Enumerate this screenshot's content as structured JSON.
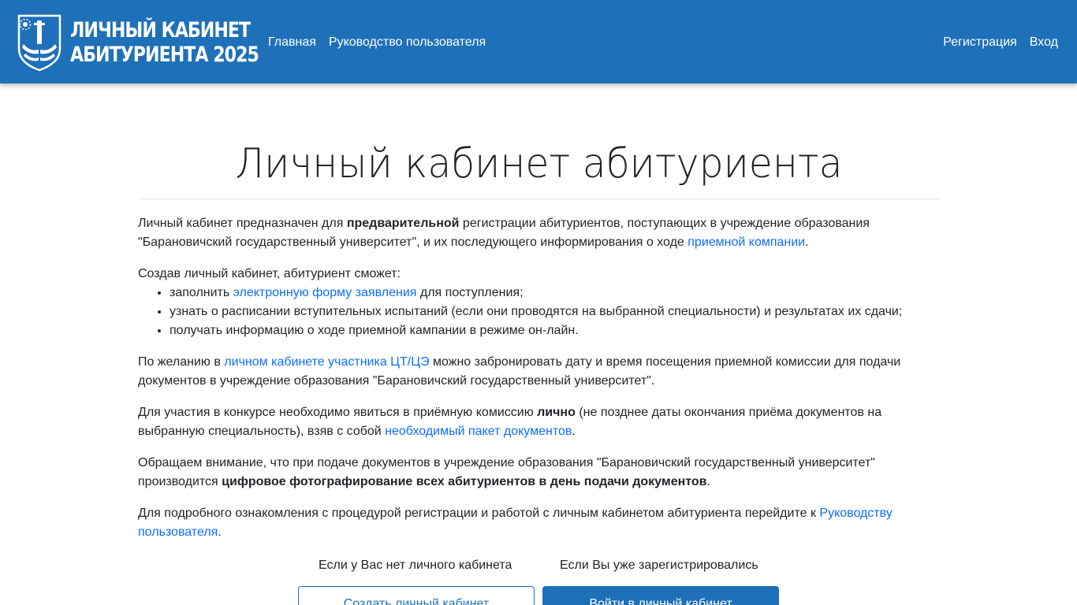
{
  "header": {
    "brand_line1": "ЛИЧНЫЙ КАБИНЕТ",
    "brand_line2": "АБИТУРИЕНТА 2025",
    "nav_home": "Главная",
    "nav_guide": "Руководство пользователя",
    "nav_register": "Регистрация",
    "nav_login": "Вход",
    "logo_icon": "university-emblem-icon",
    "bg_color": "#1e70b8"
  },
  "hero": {
    "title": "Личный кабинет абитуриента"
  },
  "content": {
    "p1": {
      "t1": "Личный кабинет предназначен для ",
      "b1": "предварительной",
      "t2": " регистрации абитуриентов, поступающих в учреждение образования \"Барановичский государственный университет\", и их последующего информирования о ходе ",
      "link": "приемной компании",
      "t3": "."
    },
    "p2_intro": "Создав личный кабинет, абитуриент сможет:",
    "list": {
      "item1_t1": "заполнить ",
      "item1_link": "электронную форму заявления",
      "item1_t2": " для поступления;",
      "item2": "узнать о расписании вступительных испытаний (если они проводятся на выбранной специальности) и результатах их сдачи;",
      "item3": "получать информацию о ходе приемной кампании в режиме он-лайн."
    },
    "p3": {
      "t1": "По желанию в ",
      "link": "личном кабинете участника ЦТ/ЦЭ",
      "t2": " можно забронировать дату и время посещения приемной комиссии для подачи документов в учреждение образования \"Барановичский государственный университет\"."
    },
    "p4": {
      "t1": "Для участия в конкурсе необходимо явиться в приёмную комиссию ",
      "b1": "лично",
      "t2": " (не позднее даты окончания приёма документов на выбранную специальность), взяв с собой ",
      "link": "необходимый пакет документов",
      "t3": "."
    },
    "p5": {
      "t1": "Обращаем внимание, что при подаче документов в учреждение образования \"Барановичский государственный университет\" производится ",
      "b1": "цифровое фотографирование всех абитуриентов в день подачи документов",
      "t2": "."
    },
    "p6": {
      "t1": "Для подробного ознакомления с процедурой регистрации и работой с личным кабинетом абитуриента перейдите к ",
      "link": "Руководству пользователя",
      "t2": "."
    },
    "link_color": "#0d6efd"
  },
  "cta": {
    "label_new": "Если у Вас нет личного кабинета",
    "label_existing": "Если Вы уже зарегистрировались",
    "btn_create": "Создать личный кабинет",
    "btn_login": "Войти в личный кабинет"
  }
}
